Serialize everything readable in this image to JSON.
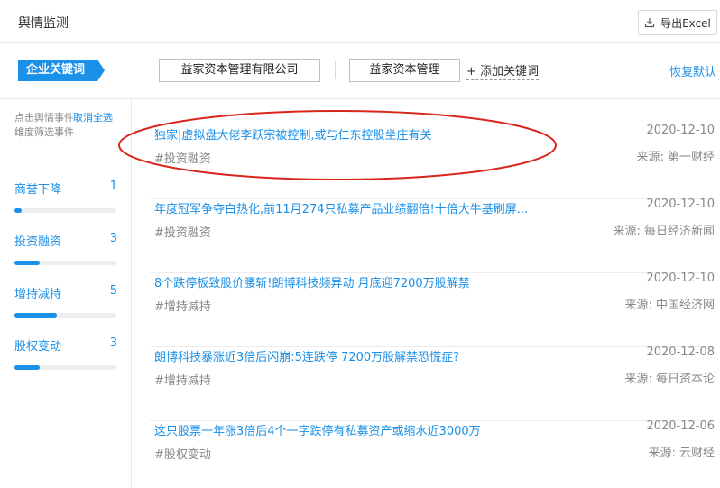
{
  "header": {
    "title": "舆情监测",
    "export_label": "导出Excel"
  },
  "keywords": {
    "tag_label": "企业关键词",
    "items": [
      "益家资本管理有限公司",
      "益家资本管理"
    ],
    "add_label": "+ 添加关键词",
    "restore_label": "恢复默认"
  },
  "sidebar": {
    "hint": "点击舆情事件维度筛选事件",
    "clear_label": "取消全选",
    "items": [
      {
        "label": "商誉下降",
        "count": "1",
        "fill": 0.07
      },
      {
        "label": "投资融资",
        "count": "3",
        "fill": 0.25
      },
      {
        "label": "增持减持",
        "count": "5",
        "fill": 0.42
      },
      {
        "label": "股权变动",
        "count": "3",
        "fill": 0.25
      }
    ]
  },
  "news": [
    {
      "title": "独家|虚拟盘大佬李跃宗被控制,或与仁东控股坐庄有关",
      "tag": "#投资融资",
      "date": "2020-12-10",
      "source": "来源: 第一财经"
    },
    {
      "title": "年度冠军争夺白热化,前11月274只私募产品业绩翻倍!十倍大牛基刷屏...",
      "tag": "#投资融资",
      "date": "2020-12-10",
      "source": "来源: 每日经济新闻"
    },
    {
      "title": "8个跌停板致股价腰斩!朗博科技频异动 月底迎7200万股解禁",
      "tag": "#增持减持",
      "date": "2020-12-10",
      "source": "来源: 中国经济网"
    },
    {
      "title": "朗博科技暴涨近3倍后闪崩:5连跌停 7200万股解禁恐慌症?",
      "tag": "#增持减持",
      "date": "2020-12-08",
      "source": "来源: 每日资本论"
    },
    {
      "title": "这只股票一年涨3倍后4个一字跌停有私募资产或缩水近3000万",
      "tag": "#股权变动",
      "date": "2020-12-06",
      "source": "来源: 云财经"
    }
  ],
  "colors": {
    "accent": "#1a90e8",
    "annotation": "#d9261c"
  }
}
